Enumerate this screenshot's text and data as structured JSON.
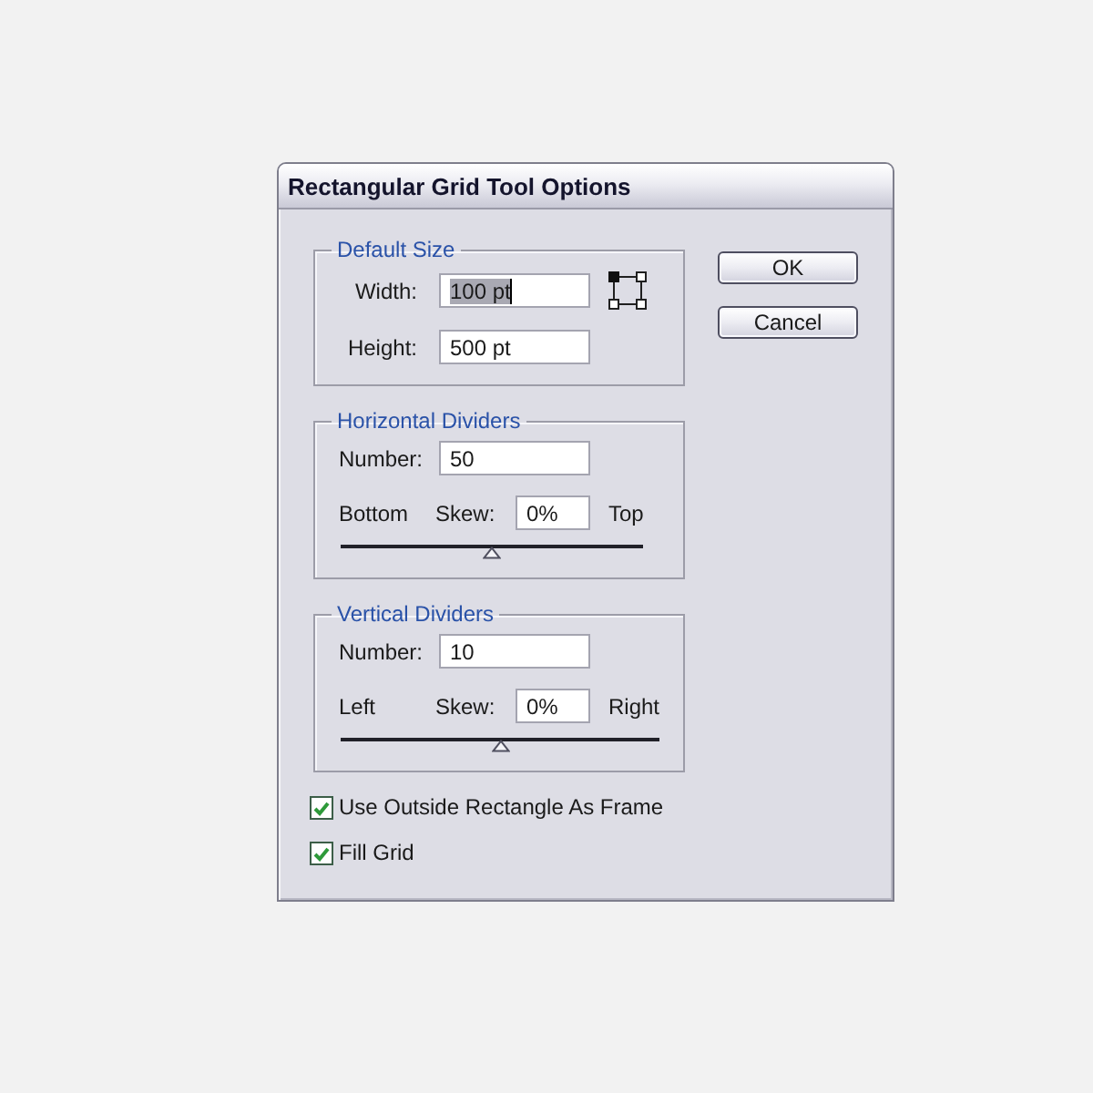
{
  "window": {
    "title": "Rectangular Grid Tool Options"
  },
  "default_size": {
    "title": "Default Size",
    "fields": [
      {
        "label": "Width:",
        "value": "100 pt",
        "text_selected": true
      },
      {
        "label": "Height:",
        "value": "500 pt",
        "text_selected": false
      }
    ]
  },
  "divider_groups": [
    {
      "title": "Horizontal Dividers",
      "number": {
        "label": "Number:",
        "value": "50"
      },
      "skew": {
        "start_label": "Bottom",
        "label": "Skew:",
        "value": "0%",
        "end_label": "Top",
        "level": 0.5
      }
    },
    {
      "title": "Vertical Dividers",
      "number": {
        "label": "Number:",
        "value": "10"
      },
      "skew": {
        "start_label": "Left",
        "label": "Skew:",
        "value": "0%",
        "end_label": "Right",
        "level": 0.5
      }
    }
  ],
  "options": [
    {
      "label": "Use Outside Rectangle As Frame",
      "checked": true
    },
    {
      "label": "Fill Grid",
      "checked": true
    }
  ],
  "buttons": [
    {
      "label": "OK"
    },
    {
      "label": "Cancel"
    }
  ]
}
